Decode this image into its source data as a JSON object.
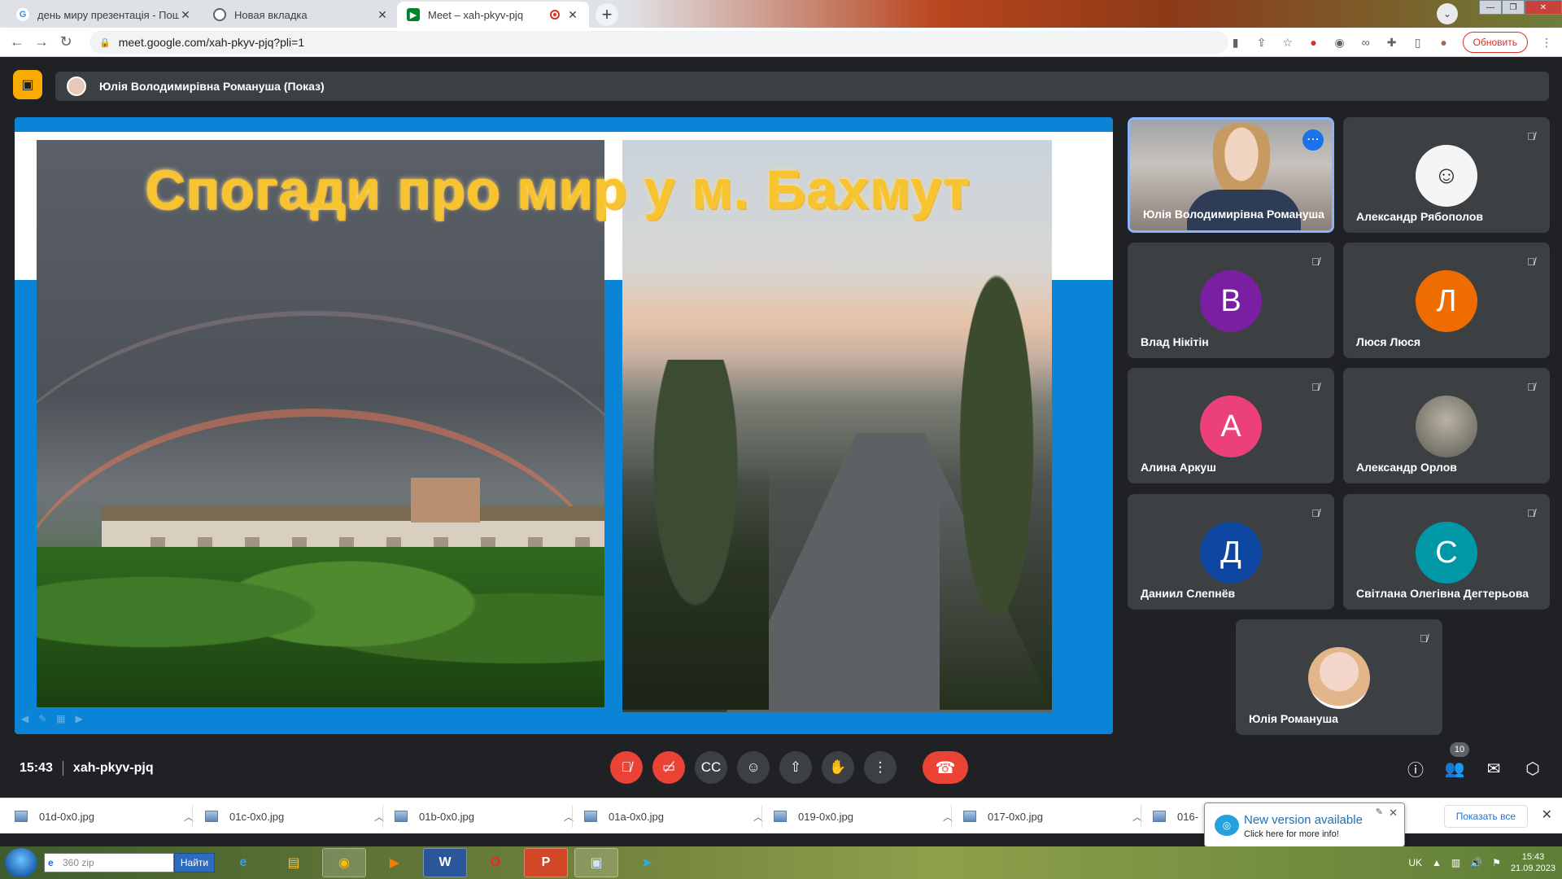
{
  "browser": {
    "tabs": [
      {
        "title": "день миру презентація - Пошук",
        "favicon": "google-icon",
        "active": false
      },
      {
        "title": "Новая вкладка",
        "favicon": "chrome-icon",
        "active": false
      },
      {
        "title": "Meet – xah-pkyv-pjq",
        "favicon": "meet-icon",
        "active": true,
        "recording": true
      }
    ],
    "address": "meet.google.com/xah-pkyv-pjq?pli=1",
    "update_label": "Обновить"
  },
  "meet": {
    "presenter_label": "Юлія Володимирівна Романуша (Показ)",
    "slide_title": "Спогади про мир у м. Бахмут",
    "participants": [
      {
        "name": "Юлія Володимирівна Романуша",
        "initial": "",
        "color": "#3c4043",
        "type": "video",
        "speaking": true
      },
      {
        "name": "Александр Рябополов",
        "initial": "",
        "color": "#ffffff",
        "type": "photo"
      },
      {
        "name": "Влад Нікітін",
        "initial": "В",
        "color": "#7b1fa2",
        "type": "letter"
      },
      {
        "name": "Люся Люся",
        "initial": "Л",
        "color": "#ef6c00",
        "type": "letter"
      },
      {
        "name": "Алина Аркуш",
        "initial": "А",
        "color": "#ec407a",
        "type": "letter"
      },
      {
        "name": "Александр Орлов",
        "initial": "",
        "color": "#8a8f8a",
        "type": "photo"
      },
      {
        "name": "Даниил Слепнёв",
        "initial": "Д",
        "color": "#0d47a1",
        "type": "letter"
      },
      {
        "name": "Світлана Олегівна Дегтерьова",
        "initial": "С",
        "color": "#0097a7",
        "type": "letter"
      },
      {
        "name": "Юлія Романуша",
        "initial": "",
        "color": "#f3d6c9",
        "type": "photo"
      }
    ],
    "time": "15:43",
    "meeting_code": "xah-pkyv-pjq",
    "people_count": "10"
  },
  "downloads": {
    "files": [
      "01d-0x0.jpg",
      "01c-0x0.jpg",
      "01b-0x0.jpg",
      "01a-0x0.jpg",
      "019-0x0.jpg",
      "017-0x0.jpg",
      "016-"
    ],
    "show_all": "Показать все"
  },
  "popup": {
    "title": "New version available",
    "subtitle": "Click here for more info!"
  },
  "taskbar": {
    "search_placeholder": "360 zip",
    "search_button": "Найти",
    "language": "UK",
    "clock_time": "15:43",
    "clock_date": "21.09.2023"
  }
}
